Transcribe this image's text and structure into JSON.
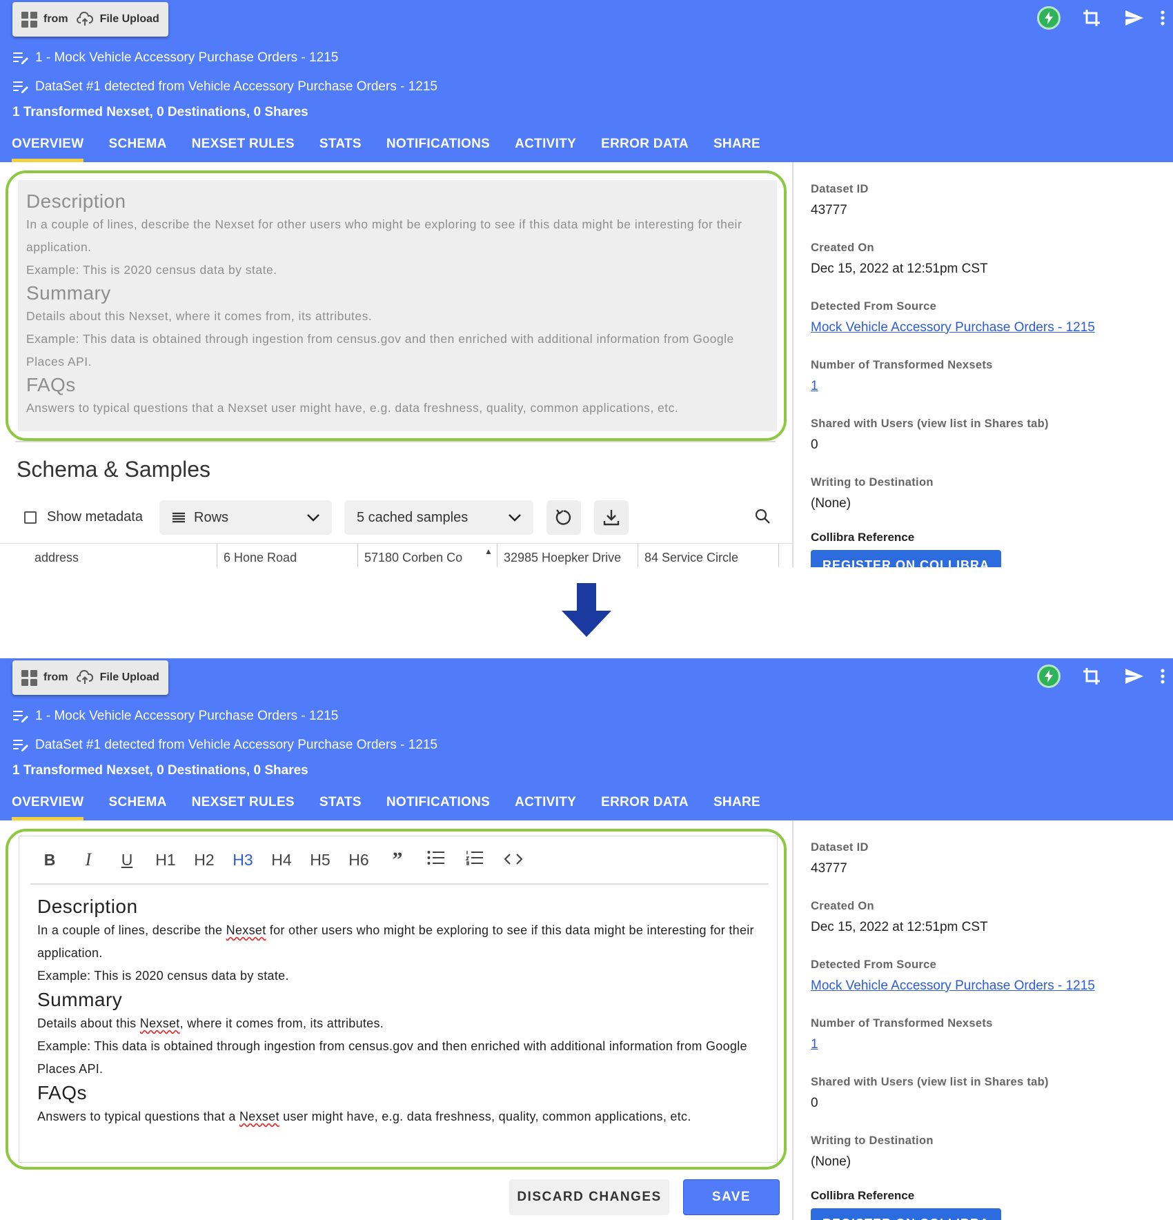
{
  "header": {
    "from_label": "from",
    "source_type": "File Upload",
    "source_name": "1 - Mock Vehicle Accessory Purchase Orders  - 1215",
    "dataset_name": "DataSet #1 detected from Vehicle Accessory Purchase Orders - 1215",
    "summary": "1 Transformed Nexset, 0 Destinations, 0 Shares",
    "icons": [
      "bolt-icon",
      "crop-icon",
      "send-icon",
      "more-vert-icon"
    ]
  },
  "tabs": [
    "OVERVIEW",
    "SCHEMA",
    "NEXSET RULES",
    "STATS",
    "NOTIFICATIONS",
    "ACTIVITY",
    "ERROR DATA",
    "SHARE"
  ],
  "description": {
    "h1": "Description",
    "p1": "In a couple of lines, describe the Nexset for other users who might be exploring to see if this data might be interesting for their application.",
    "p2": "Example: This is 2020 census data by state.",
    "h2": "Summary",
    "p3": "Details about this Nexset, where it comes from, its attributes.",
    "p4": "Example: This data is obtained through ingestion from census.gov and then enriched with additional information from Google Places API.",
    "h3": "FAQs",
    "p5": "Answers to typical questions that a Nexset user might have, e.g. data freshness, quality, common applications, etc."
  },
  "editor_text": {
    "p1_before": "In a couple of lines, describe the ",
    "nexset": "Nexset",
    "p1_after": " for other users who might be exploring to see if this data might be interesting for their application.",
    "p3_before": "Details about this ",
    "p3_after": ", where it comes from, its attributes.",
    "p5_before": "Answers to typical questions that a ",
    "p5_after": " user might have, e.g. data freshness, quality, common applications, etc."
  },
  "schema": {
    "title": "Schema & Samples",
    "show_metadata": "Show metadata",
    "view_select": "Rows",
    "samples_select": "5 cached samples",
    "table_cells": [
      "address",
      "6 Hone Road",
      "57180 Corben Co",
      "32985 Hoepker Drive",
      "84 Service Circle"
    ]
  },
  "sidebar": {
    "dataset_id_label": "Dataset ID",
    "dataset_id": "43777",
    "created_label": "Created On",
    "created": "Dec 15, 2022 at 12:51pm CST",
    "detected_label": "Detected From Source",
    "detected": "Mock Vehicle Accessory Purchase Orders - 1215",
    "transformed_label": "Number of Transformed Nexsets",
    "transformed": "1",
    "shared_label": "Shared with Users (view list in Shares tab)",
    "shared": "0",
    "writing_label": "Writing to Destination",
    "writing": "(None)",
    "collibra_label": "Collibra Reference",
    "collibra_button": "REGISTER ON COLLIBRA"
  },
  "toolbar": [
    "B",
    "I",
    "U",
    "H1",
    "H2",
    "H3",
    "H4",
    "H5",
    "H6",
    "”",
    "list",
    "ordered-list",
    "<>"
  ],
  "toolbar_active": "H3",
  "actions": {
    "discard": "DISCARD CHANGES",
    "save": "SAVE"
  },
  "colors": {
    "header_bg": "#507cf9",
    "highlight_border": "#8dc843",
    "tab_indicator": "#f4d03f",
    "arrow": "#1a3aa0"
  }
}
